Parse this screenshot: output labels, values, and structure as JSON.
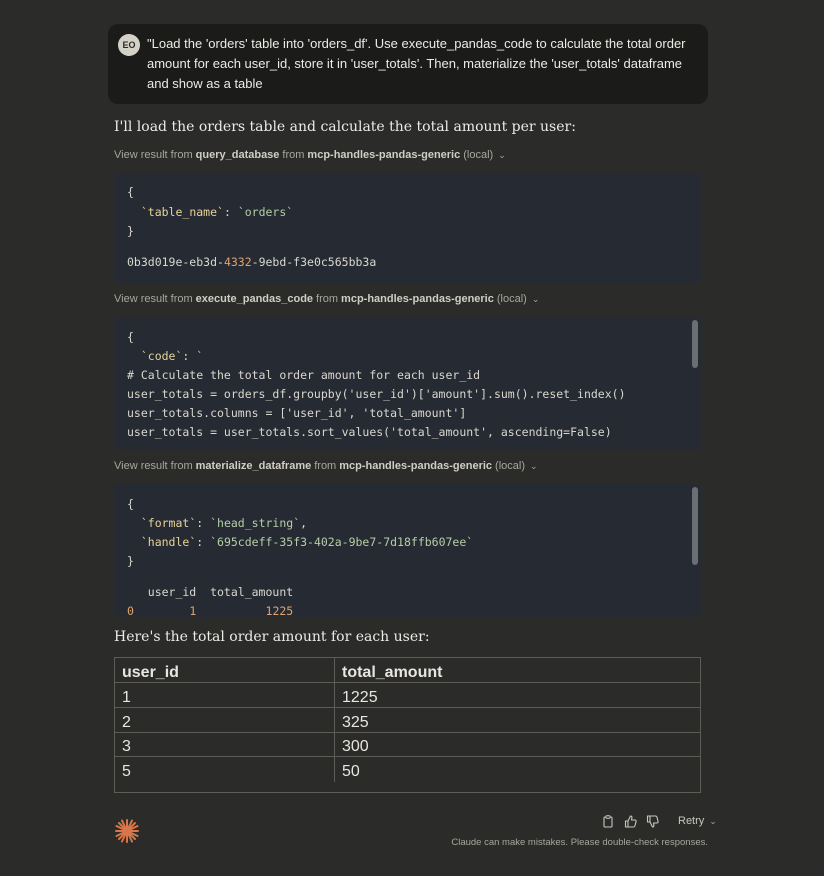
{
  "user_message": {
    "avatar_initials": "EO",
    "text": "\"Load the 'orders' table into 'orders_df'. Use execute_pandas_code to calculate the total order amount for each user_id, store it in 'user_totals'. Then, materialize the 'user_totals' dataframe and show as a table"
  },
  "assistant": {
    "intro": "I'll load the orders table and calculate the total amount per user:",
    "tool_calls": [
      {
        "prefix": "View result from",
        "tool": "query_database",
        "from": "from",
        "server": "mcp-handles-pandas-generic",
        "scope": "(local)",
        "lines": [
          "{",
          "  `table_name`: `orders`",
          "}",
          "",
          "0b3d019e-eb3d-4332-9ebd-f3e0c565bb3a"
        ]
      },
      {
        "prefix": "View result from",
        "tool": "execute_pandas_code",
        "from": "from",
        "server": "mcp-handles-pandas-generic",
        "scope": "(local)",
        "lines": [
          "{",
          "  `code`: `",
          "# Calculate the total order amount for each user_id",
          "user_totals = orders_df.groupby('user_id')['amount'].sum().reset_index()",
          "user_totals.columns = ['user_id', 'total_amount']",
          "user_totals = user_totals.sort_values('total_amount', ascending=False)"
        ]
      },
      {
        "prefix": "View result from",
        "tool": "materialize_dataframe",
        "from": "from",
        "server": "mcp-handles-pandas-generic",
        "scope": "(local)",
        "lines": [
          "{",
          "  `format`: `head_string`,",
          "  `handle`: `695cdeff-35f3-402a-9be7-7d18ffb607ee`",
          "}",
          "",
          "   user_id  total_amount",
          "0        1          1225"
        ]
      }
    ],
    "table_intro": "Here's the total order amount for each user:",
    "table": {
      "headers": [
        "user_id",
        "total_amount"
      ],
      "rows": [
        [
          "1",
          "1225"
        ],
        [
          "2",
          "325"
        ],
        [
          "3",
          "300"
        ],
        [
          "5",
          "50"
        ]
      ]
    },
    "actions": {
      "retry_label": "Retry"
    },
    "disclaimer": "Claude can make mistakes. Please double-check responses."
  },
  "colors": {
    "background": "#2b2b29",
    "code_bg": "#262a33",
    "accent": "#d9764a"
  },
  "icons": [
    "copy-icon",
    "thumbs-up-icon",
    "thumbs-down-icon",
    "chevron-down-icon",
    "claude-logo"
  ]
}
